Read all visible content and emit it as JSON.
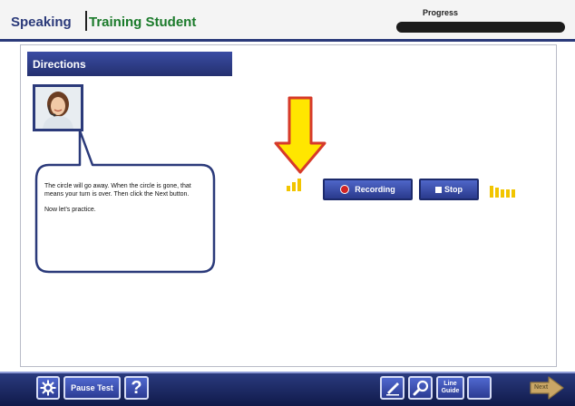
{
  "header": {
    "section": "Speaking",
    "mode": "Training Student",
    "progress_label": "Progress",
    "progress_fraction": 0
  },
  "directions": {
    "title": "Directions",
    "paragraphs": [
      "The circle will go away. When the circle is gone, that means your turn is over. Then click the Next button.",
      "Now let’s practice."
    ]
  },
  "recorder": {
    "recording_label": "Recording",
    "stop_label": "Stop"
  },
  "toolbar": {
    "pause_label": "Pause Test",
    "help_label": "?",
    "line_guide_label": "Line Guide",
    "next_label": "Next"
  },
  "colors": {
    "navy": "#2b3a7a",
    "green": "#1a7a2a",
    "arrow_yellow": "#ffe600",
    "arrow_red": "#d63a2a",
    "level_yellow": "#f2c500",
    "record_red": "#d12424"
  },
  "icons": [
    "settings-gear-icon",
    "help-question-icon",
    "highlighter-pen-icon",
    "zoom-magnifier-icon",
    "next-arrow-icon",
    "record-dot-icon",
    "stop-square-icon"
  ]
}
